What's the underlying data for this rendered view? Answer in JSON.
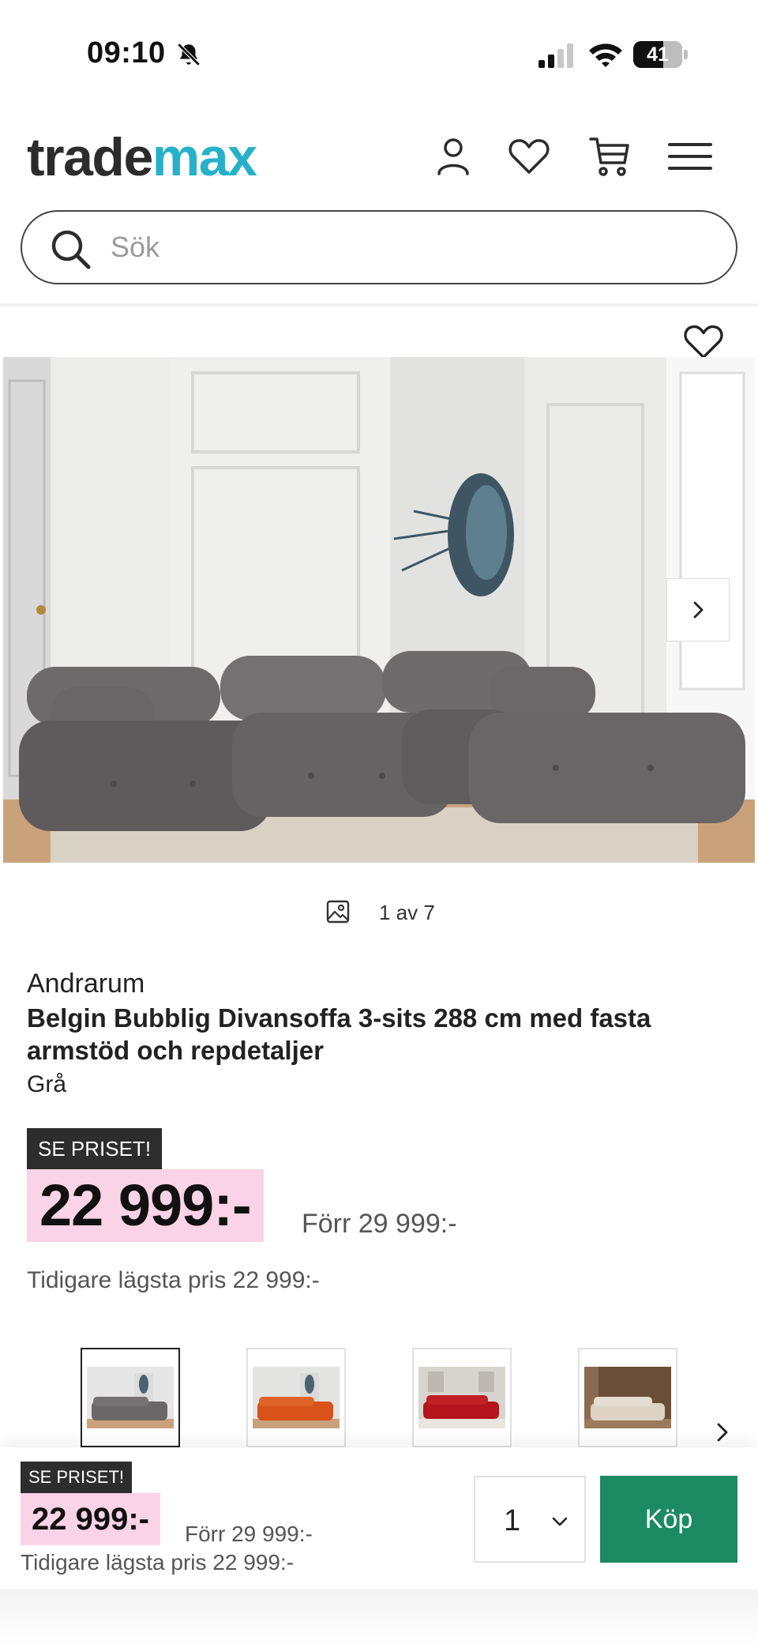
{
  "status_bar": {
    "time": "09:10",
    "battery": "41",
    "icons": [
      "bell-off-icon",
      "signal-icon",
      "wifi-icon",
      "battery-icon"
    ]
  },
  "header": {
    "logo_part1": "trade",
    "logo_part2": "max",
    "icons": [
      "user-icon",
      "heart-icon",
      "cart-icon",
      "menu-icon"
    ]
  },
  "search": {
    "placeholder": "Sök",
    "value": ""
  },
  "gallery": {
    "counter": "1 av 7"
  },
  "product": {
    "brand": "Andrarum",
    "title": "Belgin Bubblig Divansoffa 3-sits 288 cm med fasta armstöd och repdetaljer",
    "variant": "Grå",
    "badge": "SE PRISET!",
    "price": "22 999:-",
    "old_price": "Förr 29 999:-",
    "lowest_price": "Tidigare lägsta pris 22 999:-"
  },
  "thumbnails": [
    {
      "color": "#6b6667",
      "wall": "#e6e6e6"
    },
    {
      "color": "#d9521a",
      "wall": "#e4e4e2"
    },
    {
      "color": "#b4141c",
      "wall": "#d8d4cf"
    },
    {
      "color": "#ddd2c4",
      "wall": "#6b4e38"
    }
  ],
  "sticky": {
    "badge": "SE PRISET!",
    "price": "22 999:-",
    "old_price": "Förr 29 999:-",
    "lowest_price": "Tidigare lägsta pris 22 999:-",
    "quantity": "1",
    "buy_label": "Köp"
  },
  "colors": {
    "logo_accent": "#27b1c9",
    "price_highlight": "#fbd3e6",
    "buy_button": "#1c8a62"
  }
}
